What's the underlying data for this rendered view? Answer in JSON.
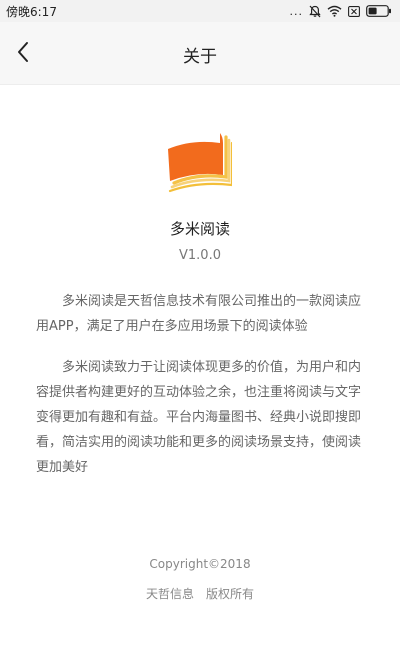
{
  "status_bar": {
    "time": "傍晚6:17",
    "dots": "...",
    "icons": [
      "mute-icon",
      "wifi-icon",
      "sim-icon",
      "battery-icon"
    ]
  },
  "navbar": {
    "title": "关于",
    "back_icon": "chevron-left-icon"
  },
  "app": {
    "name": "多米阅读",
    "version": "V1.0.0",
    "logo_colors": {
      "orange": "#f26b1d",
      "yellow": "#f4c247"
    }
  },
  "description": {
    "paragraph1": "多米阅读是天哲信息技术有限公司推出的一款阅读应用APP，满足了用户在多应用场景下的阅读体验",
    "paragraph2": "多米阅读致力于让阅读体现更多的价值，为用户和内容提供者构建更好的互动体验之余，也注重将阅读与文字变得更加有趣和有益。平台内海量图书、经典小说即搜即看，简洁实用的阅读功能和更多的阅读场景支持，使阅读更加美好"
  },
  "footer": {
    "copyright": "Copyright©2018",
    "rights": "天哲信息　版权所有"
  }
}
